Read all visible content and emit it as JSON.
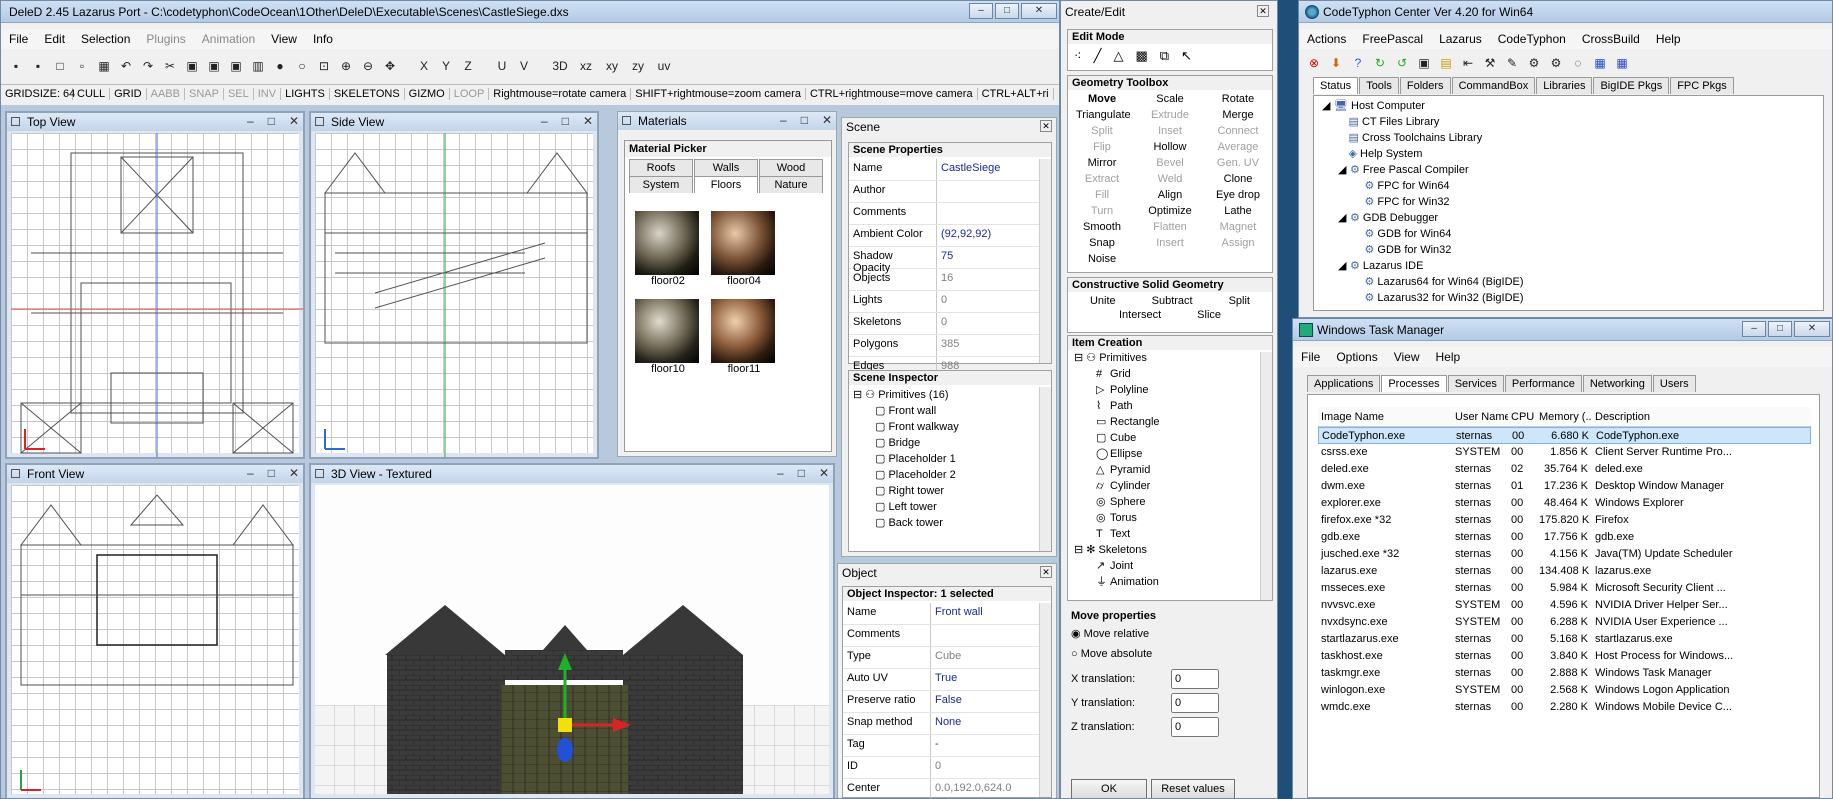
{
  "deled": {
    "title": "DeleD 2.45 Lazarus Port - C:\\codetyphon\\CodeOcean\\1Other\\DeleD\\Executable\\Scenes\\CastleSiege.dxs",
    "menu": [
      "File",
      "Edit",
      "Selection",
      "Plugins",
      "Animation",
      "View",
      "Info"
    ],
    "axis_buttons": [
      "X",
      "Y",
      "Z",
      "U",
      "V",
      "3D",
      "xz",
      "xy",
      "zy",
      "uv"
    ],
    "status": [
      "GRIDSIZE: 64",
      "CULL",
      "GRID",
      "AABB",
      "SNAP",
      "SEL",
      "INV",
      "LIGHTS",
      "SKELETONS",
      "GIZMO",
      "LOOP",
      "Rightmouse=rotate camera",
      "SHIFT+rightmouse=zoom camera",
      "CTRL+rightmouse=move camera",
      "CTRL+ALT+ri"
    ],
    "views": {
      "top": "Top View",
      "side": "Side View",
      "front": "Front View",
      "textured": "3D View - Textured"
    }
  },
  "materials": {
    "title": "Materials",
    "picker_label": "Material Picker",
    "tabs_row1": [
      "Roofs",
      "Walls",
      "Wood"
    ],
    "tabs_row2": [
      "System",
      "Floors",
      "Nature"
    ],
    "active_tab": "Floors",
    "items": [
      "floor02",
      "floor04",
      "floor10",
      "floor11"
    ]
  },
  "scene": {
    "title": "Scene",
    "props_label": "Scene Properties",
    "props": [
      {
        "k": "Name",
        "v": "CastleSiege"
      },
      {
        "k": "Author",
        "v": ""
      },
      {
        "k": "Comments",
        "v": ""
      },
      {
        "k": "Ambient Color",
        "v": "(92,92,92)"
      },
      {
        "k": "Shadow Opacity",
        "v": "75"
      },
      {
        "k": "Objects",
        "v": "16"
      },
      {
        "k": "Lights",
        "v": "0"
      },
      {
        "k": "Skeletons",
        "v": "0"
      },
      {
        "k": "Polygons",
        "v": "385"
      },
      {
        "k": "Edges",
        "v": "988"
      }
    ],
    "inspector_label": "Scene Inspector",
    "tree_root": "Primitives (16)",
    "tree_items": [
      "Front wall",
      "Front walkway",
      "Bridge",
      "Placeholder 1",
      "Placeholder 2",
      "Right tower",
      "Left tower",
      "Back tower"
    ]
  },
  "object": {
    "title": "Object",
    "inspector_label": "Object Inspector: 1 selected",
    "props": [
      {
        "k": "Name",
        "v": "Front wall"
      },
      {
        "k": "Comments",
        "v": ""
      },
      {
        "k": "Type",
        "v": "Cube"
      },
      {
        "k": "Auto UV",
        "v": "True"
      },
      {
        "k": "Preserve ratio",
        "v": "False"
      },
      {
        "k": "Snap method",
        "v": "None"
      },
      {
        "k": "Tag",
        "v": "-"
      },
      {
        "k": "ID",
        "v": "0"
      },
      {
        "k": "Center",
        "v": "0.0,192.0,624.0"
      }
    ]
  },
  "create": {
    "title": "Create/Edit",
    "edit_mode": "Edit Mode",
    "geom_label": "Geometry Toolbox",
    "geom": [
      [
        "Move",
        "Scale",
        "Rotate"
      ],
      [
        "Triangulate",
        "Extrude",
        "Merge"
      ],
      [
        "Split",
        "Inset",
        "Connect"
      ],
      [
        "Flip",
        "Hollow",
        "Average"
      ],
      [
        "Mirror",
        "Bevel",
        "Gen. UV"
      ],
      [
        "Extract",
        "Weld",
        "Clone"
      ],
      [
        "Fill",
        "Align",
        "Eye drop"
      ],
      [
        "Turn",
        "Optimize",
        "Lathe"
      ],
      [
        "Smooth",
        "Flatten",
        "Magnet"
      ],
      [
        "Snap",
        "Insert",
        "Assign"
      ],
      [
        "Noise",
        "",
        ""
      ]
    ],
    "csg_label": "Constructive Solid Geometry",
    "csg": [
      "Unite",
      "Subtract",
      "Split",
      "Intersect",
      "Slice"
    ],
    "item_label": "Item Creation",
    "items_root": "Primitives",
    "items": [
      "Grid",
      "Polyline",
      "Path",
      "Rectangle",
      "Cube",
      "Ellipse",
      "Pyramid",
      "Cylinder",
      "Sphere",
      "Torus",
      "Text"
    ],
    "skeleton_root": "Skeletons",
    "skeleton_items": [
      "Joint",
      "Animation"
    ],
    "move_label": "Move properties",
    "move_relative": "Move relative",
    "move_absolute": "Move absolute",
    "x_label": "X translation:",
    "y_label": "Y translation:",
    "z_label": "Z translation:",
    "x_val": "0",
    "y_val": "0",
    "z_val": "0",
    "ok": "OK",
    "reset": "Reset values"
  },
  "codetyphon": {
    "title": "CodeTyphon Center Ver 4.20 for Win64",
    "menu": [
      "Actions",
      "FreePascal",
      "Lazarus",
      "CodeTyphon",
      "CrossBuild",
      "Help"
    ],
    "tabs": [
      "Status",
      "Tools",
      "Folders",
      "CommandBox",
      "Libraries",
      "BigIDE Pkgs",
      "FPC Pkgs"
    ],
    "tree": [
      {
        "indent": 0,
        "text": "Host Computer"
      },
      {
        "indent": 1,
        "text": "CT Files Library"
      },
      {
        "indent": 1,
        "text": "Cross Toolchains Library"
      },
      {
        "indent": 1,
        "text": "Help System"
      },
      {
        "indent": 1,
        "text": "Free Pascal Compiler"
      },
      {
        "indent": 2,
        "text": "FPC for Win64"
      },
      {
        "indent": 2,
        "text": "FPC for Win32"
      },
      {
        "indent": 1,
        "text": "GDB Debugger"
      },
      {
        "indent": 2,
        "text": "GDB for Win64"
      },
      {
        "indent": 2,
        "text": "GDB for Win32"
      },
      {
        "indent": 1,
        "text": "Lazarus IDE"
      },
      {
        "indent": 2,
        "text": "Lazarus64 for Win64 (BigIDE)"
      },
      {
        "indent": 2,
        "text": "Lazarus32 for Win32 (BigIDE)"
      }
    ]
  },
  "taskmgr": {
    "title": "Windows Task Manager",
    "menu": [
      "File",
      "Options",
      "View",
      "Help"
    ],
    "tabs": [
      "Applications",
      "Processes",
      "Services",
      "Performance",
      "Networking",
      "Users"
    ],
    "columns": [
      "Image Name",
      "User Name",
      "CPU",
      "Memory (...",
      "Description"
    ],
    "rows": [
      [
        "CodeTyphon.exe",
        "sternas",
        "00",
        "6.680 K",
        "CodeTyphon.exe"
      ],
      [
        "csrss.exe",
        "SYSTEM",
        "00",
        "1.856 K",
        "Client Server Runtime Pro..."
      ],
      [
        "deled.exe",
        "sternas",
        "02",
        "35.764 K",
        "deled.exe"
      ],
      [
        "dwm.exe",
        "sternas",
        "01",
        "17.236 K",
        "Desktop Window Manager"
      ],
      [
        "explorer.exe",
        "sternas",
        "00",
        "48.464 K",
        "Windows Explorer"
      ],
      [
        "firefox.exe *32",
        "sternas",
        "00",
        "175.820 K",
        "Firefox"
      ],
      [
        "gdb.exe",
        "sternas",
        "00",
        "17.756 K",
        "gdb.exe"
      ],
      [
        "jusched.exe *32",
        "sternas",
        "00",
        "4.156 K",
        "Java(TM) Update Scheduler"
      ],
      [
        "lazarus.exe",
        "sternas",
        "00",
        "134.408 K",
        "lazarus.exe"
      ],
      [
        "msseces.exe",
        "sternas",
        "00",
        "5.984 K",
        "Microsoft Security Client ..."
      ],
      [
        "nvvsvc.exe",
        "SYSTEM",
        "00",
        "4.596 K",
        "NVIDIA Driver Helper Ser..."
      ],
      [
        "nvxdsync.exe",
        "SYSTEM",
        "00",
        "6.288 K",
        "NVIDIA User Experience ..."
      ],
      [
        "startlazarus.exe",
        "sternas",
        "00",
        "5.168 K",
        "startlazarus.exe"
      ],
      [
        "taskhost.exe",
        "sternas",
        "00",
        "3.840 K",
        "Host Process for Windows..."
      ],
      [
        "taskmgr.exe",
        "sternas",
        "00",
        "2.888 K",
        "Windows Task Manager"
      ],
      [
        "winlogon.exe",
        "SYSTEM",
        "00",
        "2.568 K",
        "Windows Logon Application"
      ],
      [
        "wmdc.exe",
        "sternas",
        "00",
        "2.280 K",
        "Windows Mobile Device C..."
      ]
    ]
  },
  "colors": {
    "accent_blue": "#1a2a9a",
    "selected_row": "#cde6fb",
    "gizmo_green": "#1fb02a",
    "gizmo_red": "#d82424",
    "gizmo_yellow": "#f3e00a",
    "gizmo_blue": "#2450d8"
  }
}
